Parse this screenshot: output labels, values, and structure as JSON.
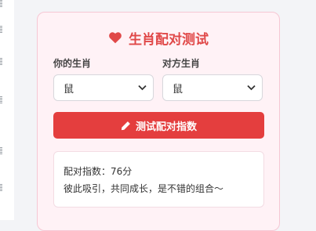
{
  "card": {
    "title": "生肖配对测试",
    "my_label": "你的生肖",
    "my_value": "鼠",
    "partner_label": "对方生肖",
    "partner_value": "鼠",
    "button_label": "测试配对指数",
    "result_score": "配对指数：76分",
    "result_text": "彼此吸引，共同成长，是不错的组合～"
  },
  "icons": {
    "title_icon": "heart-icon",
    "button_icon": "pencil-icon",
    "select_icon": "chevron-down-icon"
  },
  "colors": {
    "accent": "#e43e3e",
    "card_bg": "#fff2f6",
    "card_border": "#f6c7d4"
  }
}
